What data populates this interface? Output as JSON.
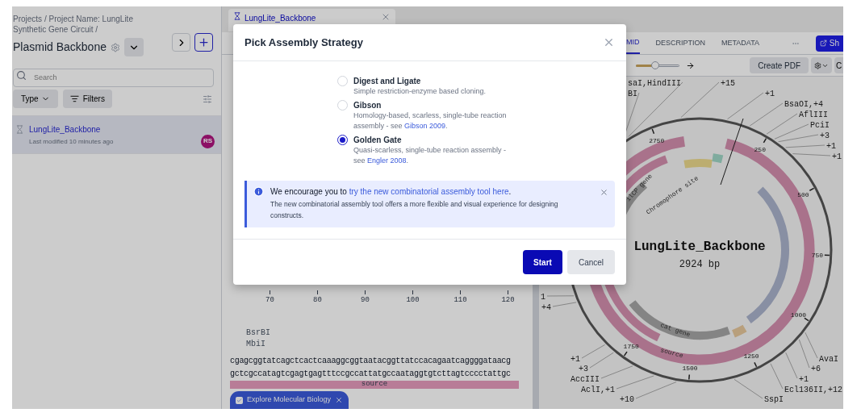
{
  "sidebar": {
    "breadcrumb": "Projects / Project Name: LungLite Synthetic Gene Circuit /",
    "title": "Plasmid Backbone",
    "search": {
      "placeholder": "Search"
    },
    "type_filter": "Type",
    "filters_button": "Filters",
    "files": [
      {
        "name": "LungLite_Backbone",
        "modified": "Last modified 10 minutes ago",
        "avatar": "RS",
        "selected": true
      }
    ]
  },
  "document_tab": {
    "title": "LungLite_Backbone"
  },
  "view_tabs": [
    {
      "label": "MID",
      "selected": true
    },
    {
      "label": "DESCRIPTION",
      "selected": false
    },
    {
      "label": "METADATA",
      "selected": false
    }
  ],
  "share_button": "Sh",
  "map_toolbar": {
    "zoom": {
      "level": 0.45
    },
    "create_pdf": "Create PDF",
    "cut_button": "C"
  },
  "sequence": {
    "ruler": [
      "70",
      "80",
      "90",
      "100",
      "110",
      "120"
    ],
    "enzymes": [
      "BsrBI",
      "MbiI"
    ],
    "top_strand": "cgagcggtatcagctcactcaaaggcggtaatacggttatccacagaatcaggggataacg",
    "bottom_strand": "gctcgccatagtcgagtgagtttccgccattatgccaataggtgtcttagtcccctattgc",
    "feature": "source",
    "tour_chip": {
      "label": "Explore Molecular Biology",
      "checked": true
    }
  },
  "plasmid_map": {
    "name": "LungLite_Backbone",
    "length": "2924 bp",
    "position_ticks": [
      "2750",
      "250",
      "500",
      "750",
      "1000",
      "1250",
      "1500",
      "1750"
    ],
    "feature_labels": [
      "ilCP gene",
      "Chromophore site",
      "cat gene",
      "source"
    ],
    "cut_sites": [
      "saI,HindIII",
      "BI",
      "+15",
      "+1",
      "BsaOI,+4",
      "AflIII",
      "PciI",
      "+3",
      "+1",
      "+1",
      "1",
      "+4",
      "+1",
      "+3",
      "AccIII",
      "AclI,+1",
      "+10",
      "SspI",
      "Ecl136II,+12",
      "+1",
      "+6",
      "AvaI"
    ]
  },
  "dialog": {
    "title": "Pick Assembly Strategy",
    "options": [
      {
        "label": "Digest and Ligate",
        "description": "Simple restriction-enzyme based cloning.",
        "selected": false
      },
      {
        "label": "Gibson",
        "description": "Homology-based, scarless, single-tube reaction assembly - see ",
        "link": "Gibson 2009",
        "end": ".",
        "selected": false
      },
      {
        "label": "Golden Gate",
        "description": "Quasi-scarless, single-tube reaction assembly - see ",
        "link": "Engler 2008",
        "end": ".",
        "selected": true
      }
    ],
    "notice": {
      "lead": "We encourage you to ",
      "link": "try the new combinatorial assembly tool here",
      "end": ".",
      "text": "The new combinatorial assembly tool offers a more flexible and visual experience for designing constructs."
    },
    "buttons": [
      {
        "label": "Start",
        "kind": "primary"
      },
      {
        "label": "Cancel",
        "kind": "secondary"
      }
    ]
  }
}
